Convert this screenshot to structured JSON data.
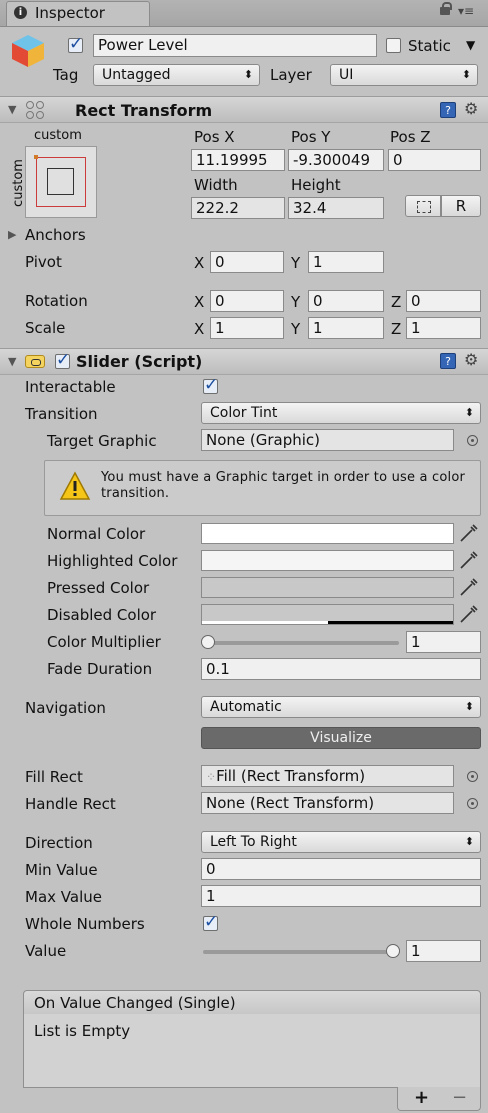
{
  "tab": {
    "title": "Inspector"
  },
  "gameobject": {
    "name": "Power Level",
    "static_label": "Static",
    "tag_label": "Tag",
    "tag_value": "Untagged",
    "layer_label": "Layer",
    "layer_value": "UI"
  },
  "rect_transform": {
    "title": "Rect Transform",
    "anchor_h": "custom",
    "anchor_v": "custom",
    "posx_label": "Pos X",
    "posy_label": "Pos Y",
    "posz_label": "Pos Z",
    "posx": "11.19995",
    "posy": "-9.300049",
    "posz": "0",
    "width_label": "Width",
    "height_label": "Height",
    "width": "222.2",
    "height": "32.4",
    "raw_button": "R",
    "anchors_label": "Anchors",
    "pivot_label": "Pivot",
    "pivot_x": "0",
    "pivot_y": "1",
    "rotation_label": "Rotation",
    "rot_x": "0",
    "rot_y": "0",
    "rot_z": "0",
    "scale_label": "Scale",
    "scale_x": "1",
    "scale_y": "1",
    "scale_z": "1",
    "x_axis": "X",
    "y_axis": "Y",
    "z_axis": "Z"
  },
  "slider": {
    "title": "Slider (Script)",
    "interactable_label": "Interactable",
    "transition_label": "Transition",
    "transition_value": "Color Tint",
    "target_graphic_label": "Target Graphic",
    "target_graphic_value": "None (Graphic)",
    "warning": "You must have a Graphic target in order to use a color transition.",
    "normal_color_label": "Normal Color",
    "highlighted_color_label": "Highlighted Color",
    "pressed_color_label": "Pressed Color",
    "disabled_color_label": "Disabled Color",
    "color_multiplier_label": "Color Multiplier",
    "color_multiplier_value": "1",
    "fade_duration_label": "Fade Duration",
    "fade_duration_value": "0.1",
    "navigation_label": "Navigation",
    "navigation_value": "Automatic",
    "visualize_label": "Visualize",
    "fill_rect_label": "Fill Rect",
    "fill_rect_value": "Fill (Rect Transform)",
    "handle_rect_label": "Handle Rect",
    "handle_rect_value": "None (Rect Transform)",
    "direction_label": "Direction",
    "direction_value": "Left To Right",
    "min_value_label": "Min Value",
    "min_value": "0",
    "max_value_label": "Max Value",
    "max_value": "1",
    "whole_numbers_label": "Whole Numbers",
    "value_label": "Value",
    "value": "1",
    "value_fraction": 1.0,
    "color_multiplier_fraction": 0.0
  },
  "event": {
    "title": "On Value Changed (Single)",
    "empty": "List is Empty",
    "add": "+",
    "remove": "−"
  },
  "colors": {
    "background": "#c2c2c2",
    "normal_color": "#ffffff",
    "highlighted_color": "#f5f5f5",
    "pressed_color": "#c8c8c8",
    "disabled_color": "#c8c8c8",
    "visualize_bg": "#6a6a6a"
  }
}
